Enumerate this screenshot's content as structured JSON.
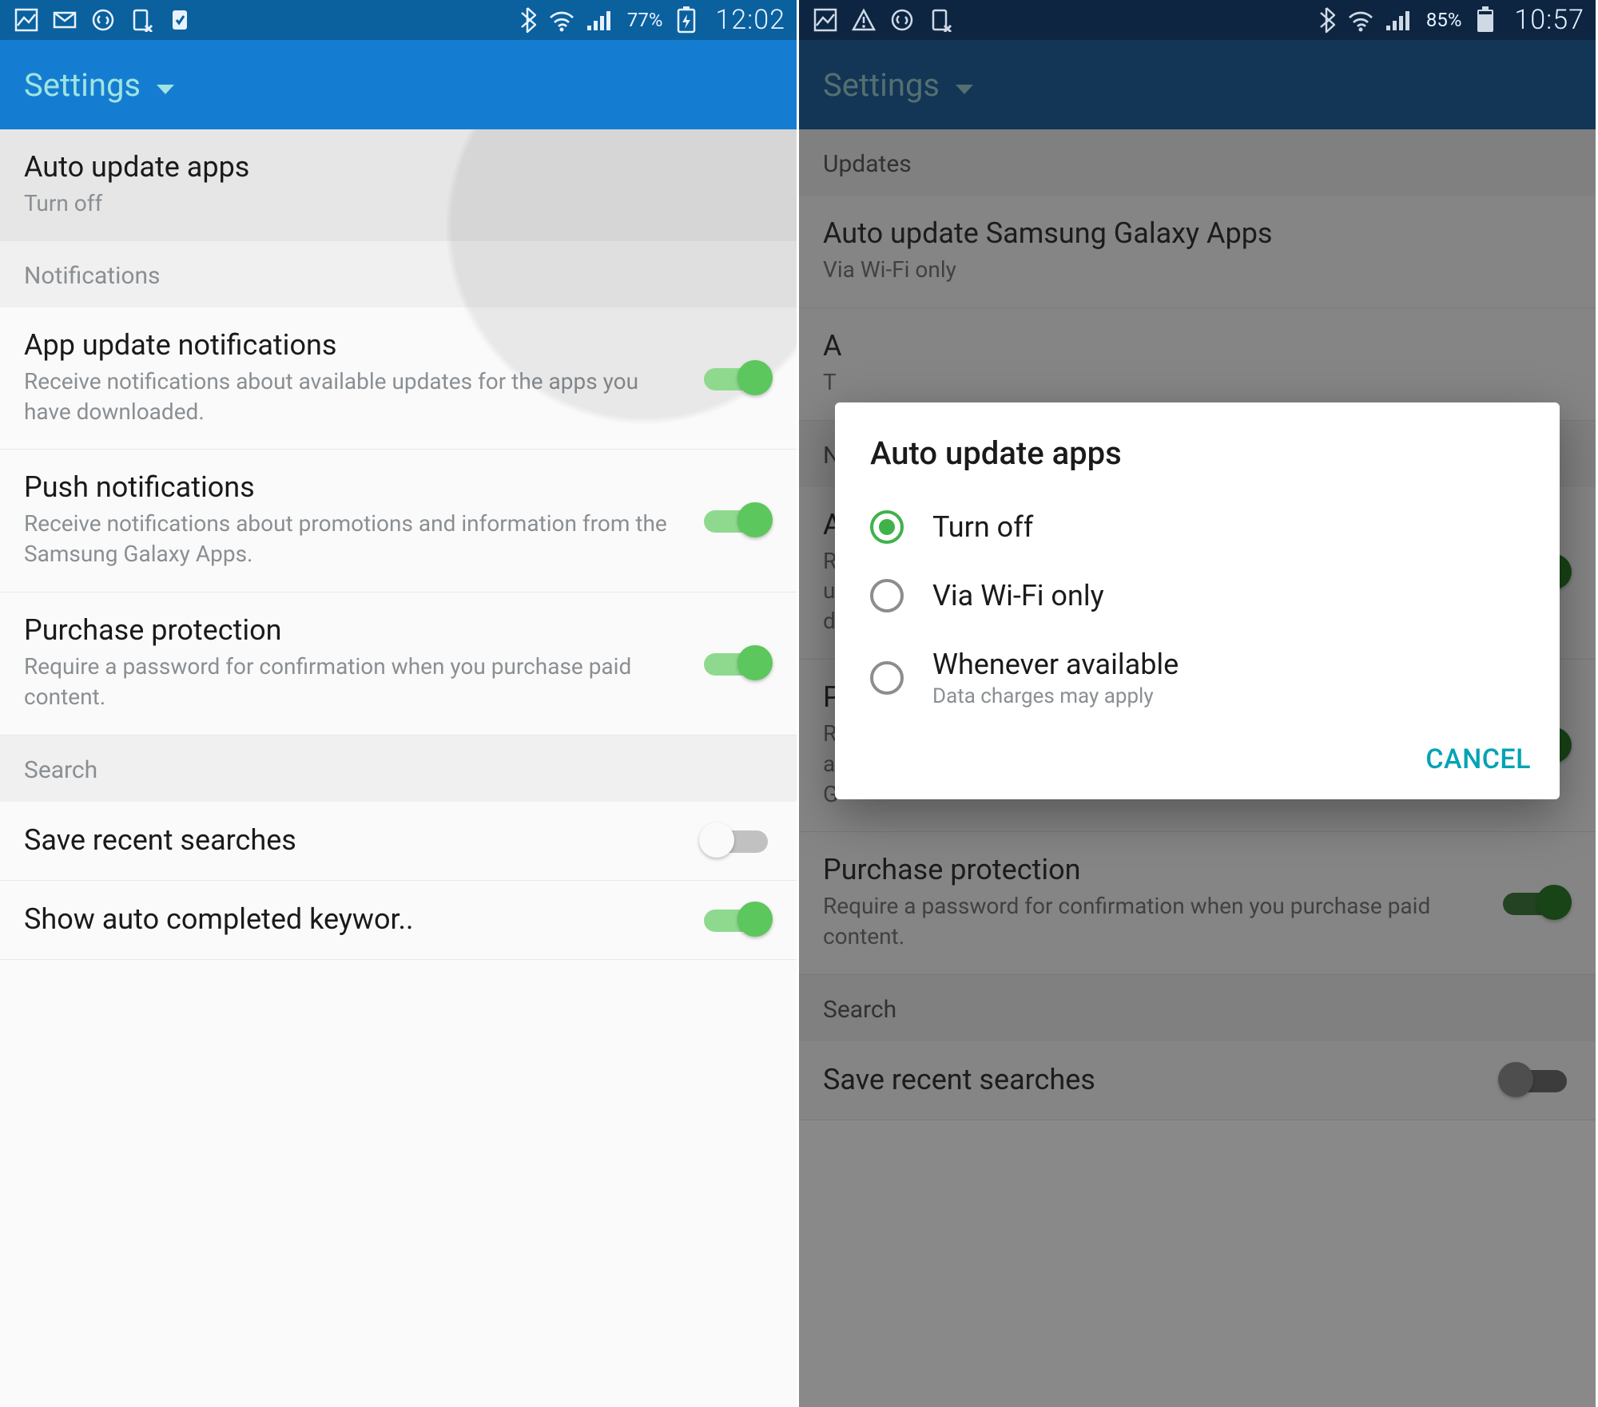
{
  "left": {
    "status": {
      "battery": "77%",
      "clock": "12:02"
    },
    "appbar_title": "Settings",
    "top_item": {
      "title": "Auto update apps",
      "sub": "Turn off"
    },
    "cat_notifications": "Notifications",
    "items_notifications": [
      {
        "title": "App update notifications",
        "sub": "Receive notifications about available updates for the apps you have downloaded.",
        "on": true
      },
      {
        "title": "Push notifications",
        "sub": "Receive notifications about promotions and information from the Samsung Galaxy Apps.",
        "on": true
      },
      {
        "title": "Purchase protection",
        "sub": "Require a password for confirmation when you purchase paid content.",
        "on": true
      }
    ],
    "cat_search": "Search",
    "items_search": [
      {
        "title": "Save recent searches",
        "on": false
      },
      {
        "title": "Show auto completed keywor..",
        "on": true
      }
    ]
  },
  "right": {
    "status": {
      "battery": "85%",
      "clock": "10:57"
    },
    "appbar_title": "Settings",
    "cat_updates": "Updates",
    "bg_items": [
      {
        "title": "Auto update Samsung Galaxy Apps",
        "sub": "Via Wi-Fi only"
      },
      {
        "title": "A",
        "sub": "T"
      }
    ],
    "cat_notifications_initial": "N",
    "bg_notif": [
      {
        "title": "A",
        "sub": "R\nu\nd",
        "on": true
      },
      {
        "title": "P",
        "sub": "R\na\nG",
        "on": true
      }
    ],
    "bg_purchase": {
      "title": "Purchase protection",
      "sub": "Require a password for confirmation when you purchase paid content.",
      "on": true
    },
    "cat_search": "Search",
    "bg_search_item": {
      "title": "Save recent searches",
      "on": false
    },
    "dialog": {
      "title": "Auto update apps",
      "options": [
        {
          "label": "Turn off",
          "selected": true
        },
        {
          "label": "Via Wi-Fi only",
          "selected": false
        },
        {
          "label": "Whenever available",
          "sub": "Data charges may apply",
          "selected": false
        }
      ],
      "cancel": "CANCEL"
    }
  }
}
